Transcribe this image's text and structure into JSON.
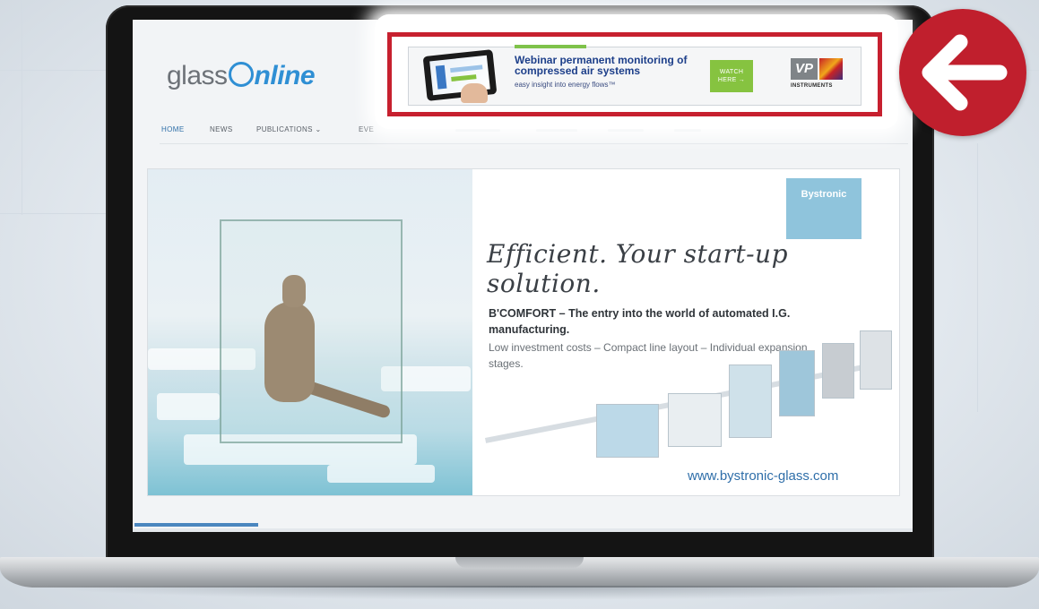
{
  "site": {
    "logo_part1": "glass",
    "logo_part2": "nline",
    "nav": [
      "HOME",
      "NEWS",
      "PUBLICATIONS ⌄",
      "EVE"
    ]
  },
  "banner": {
    "title": "Webinar permanent monitoring of compressed air systems",
    "subtitle": "easy insight into energy flows™",
    "cta": "WATCH HERE →",
    "brand_mark": "VP",
    "brand_name": "INSTRUMENTS"
  },
  "ad": {
    "brand": "Bystronic",
    "slogan": "Efficient. Your start-up solution.",
    "headline": "B'COMFORT – The entry into the world of automated I.G. manufacturing.",
    "body": "Low investment costs – Compact line layout – Individual expansion stages.",
    "url": "www.bystronic-glass.com"
  },
  "colors": {
    "highlight": "#c7202f",
    "arrow_badge": "#c01f2d",
    "brand_blue": "#2f8fd4",
    "banner_green": "#86c340"
  },
  "icons": {
    "arrow_badge": "arrow-left-icon"
  }
}
